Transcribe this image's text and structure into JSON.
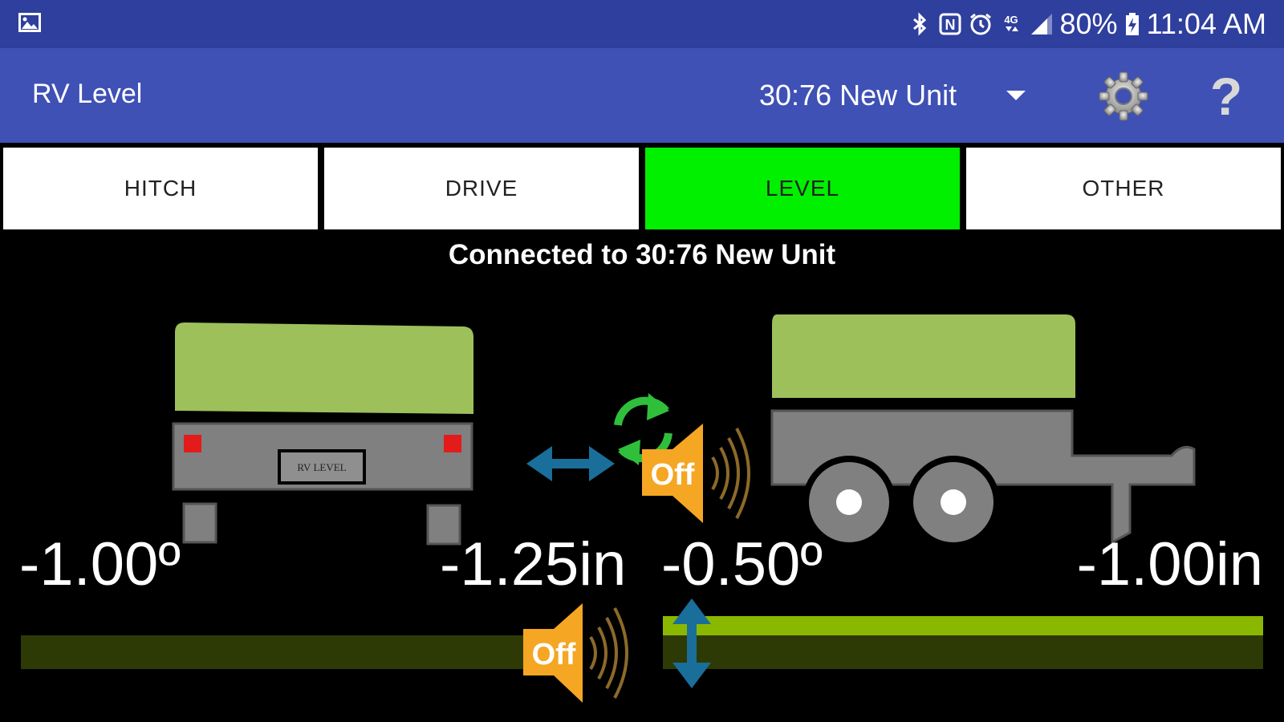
{
  "status_bar": {
    "battery": "80%",
    "time": "11:04 AM",
    "icons": [
      "gallery-icon",
      "bluetooth-icon",
      "nfc-icon",
      "alarm-icon",
      "lte-icon",
      "signal-icon",
      "battery-charging-icon"
    ]
  },
  "app_bar": {
    "title": "RV Level",
    "unit_selected": "30:76 New Unit",
    "icons": [
      "dropdown-caret-icon",
      "settings-gear-icon",
      "help-icon"
    ]
  },
  "tabs": [
    {
      "label": "HITCH",
      "active": false
    },
    {
      "label": "DRIVE",
      "active": false
    },
    {
      "label": "LEVEL",
      "active": true
    },
    {
      "label": "OTHER",
      "active": false
    }
  ],
  "connection_status": "Connected to 30:76 New Unit",
  "rear_view": {
    "angle": "-1.00º",
    "height": "-1.25in",
    "plate_text": "RV LEVEL",
    "sound_label": "Off"
  },
  "side_view": {
    "angle": "-0.50º",
    "height": "-1.00in",
    "sound_label": "Off"
  },
  "colors": {
    "status_bar": "#2f3f9e",
    "app_bar": "#3f51b5",
    "active_tab": "#00f000",
    "canopy": "#9dc05b",
    "body": "#808080",
    "level_bar_dark": "#2e3a06",
    "level_bar_light": "#8ab800",
    "speaker": "#f5a623",
    "arrow": "#1a6e9a",
    "refresh": "#2fbf3a"
  }
}
